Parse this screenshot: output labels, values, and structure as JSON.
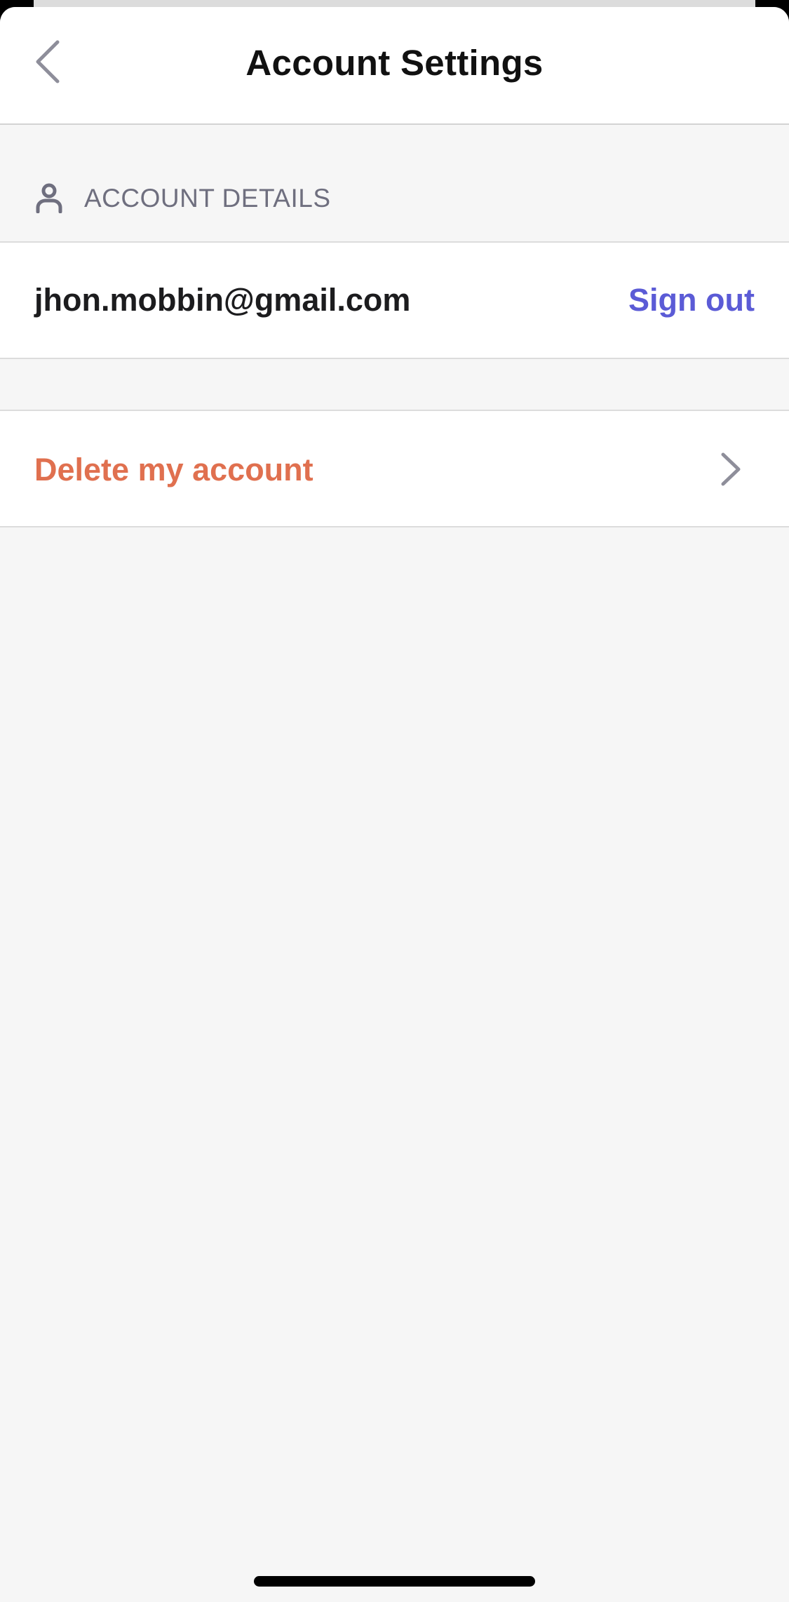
{
  "nav": {
    "title": "Account Settings",
    "back_icon": "chevron-left-icon"
  },
  "section": {
    "title": "ACCOUNT DETAILS",
    "icon": "person-icon"
  },
  "account": {
    "email": "jhon.mobbin@gmail.com",
    "sign_out_label": "Sign out"
  },
  "danger": {
    "delete_label": "Delete my account",
    "chevron_icon": "chevron-right-icon"
  },
  "colors": {
    "accent": "#5b5bd6",
    "danger": "#e0704f",
    "background": "#f6f6f6"
  }
}
